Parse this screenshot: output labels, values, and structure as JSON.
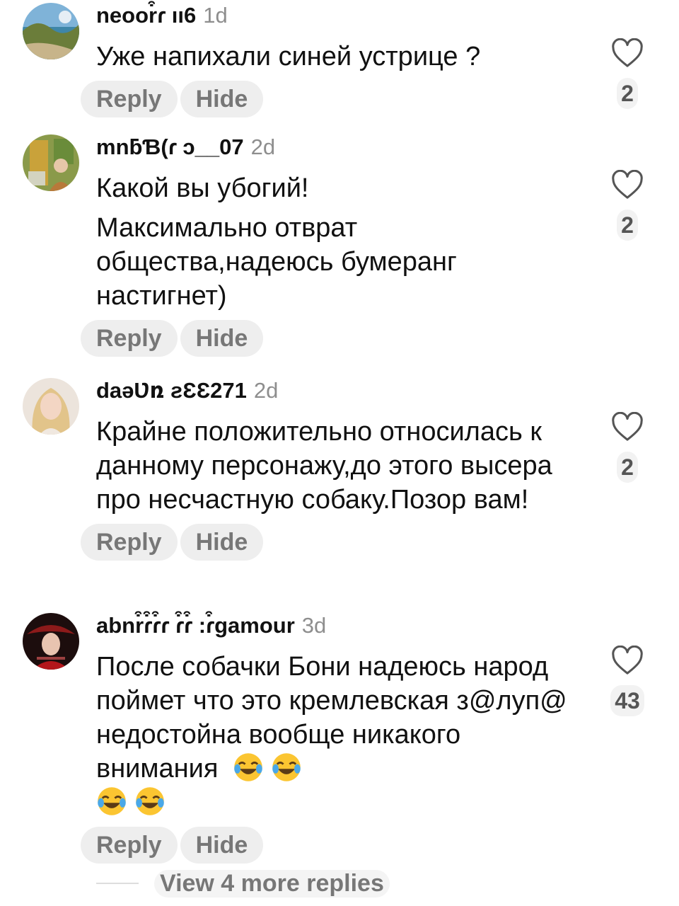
{
  "comments": [
    {
      "username": "neoor͒ɾ ıı6",
      "time": "1d",
      "paragraphs": [
        "Уже напихали синей устрице ?"
      ],
      "reply_label": "Reply",
      "hide_label": "Hide",
      "likes": "2"
    },
    {
      "username": "mnƃƁ(ɾ ɔ__07",
      "time": "2d",
      "paragraphs": [
        "Какой вы убогий!",
        "Максимально отврат общества,надеюсь бумеранг настигнет)"
      ],
      "reply_label": "Reply",
      "hide_label": "Hide",
      "likes": "2"
    },
    {
      "username": "daəƲռ ƨƐƐ271",
      "time": "2d",
      "paragraphs": [
        "Крайне положительно относилась к данному персонажу,до этого высера про несчастную собаку.Позор вам!"
      ],
      "reply_label": "Reply",
      "hide_label": "Hide",
      "likes": "2"
    },
    {
      "username": "abnr͒ɾ͒ɾ͒ɾ ɾ͒ɾ͒ :ɾ͒ɡamour",
      "time": "3d",
      "paragraphs": [
        "После собачки Бони надеюсь народ поймет что это кремлевская з@луп@ недостойна вообще никакого внимания"
      ],
      "reply_label": "Reply",
      "hide_label": "Hide",
      "likes": "43"
    }
  ],
  "view_more": "View 4 more replies",
  "icons": {
    "like": "heart-outline-icon",
    "emoji": "face-with-tears-of-joy-icon"
  },
  "colors": {
    "text": "#111111",
    "muted": "#8e8e8e",
    "pill_bg": "#eeeeee"
  }
}
